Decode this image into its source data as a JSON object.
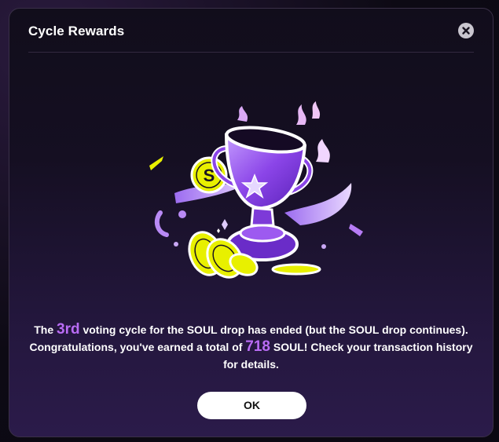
{
  "dialog": {
    "title": "Cycle Rewards",
    "close_icon": "close-icon",
    "illustration": "trophy-with-soul-coins",
    "message": {
      "part1": "The ",
      "cycle": "3rd",
      "part2": " voting cycle for the SOUL drop has ended (but the SOUL drop continues). Congratulations, you've earned a total of ",
      "amount": "718",
      "part3": " SOUL! Check your transaction history for details."
    },
    "ok_label": "OK",
    "coin_letter": "S"
  },
  "colors": {
    "accent": "#b96cf5",
    "coin": "#e8f000",
    "trophy": "#8b45e8"
  }
}
